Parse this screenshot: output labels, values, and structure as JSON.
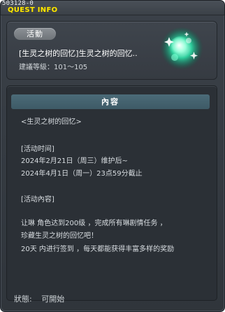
{
  "window": {
    "quest_id": "503128-0",
    "title": "QUEST INFO"
  },
  "quest": {
    "category": "活動",
    "name": "[生灵之树的回忆]生灵之树的回忆..",
    "level": "建議等級：101～105",
    "icon": "glowing-orb-icon"
  },
  "content": {
    "header": "內容",
    "lines": [
      "<生灵之树的回忆>",
      "",
      "[活动时间]",
      "2024年2月21日（周三）维护后~",
      "2024年4月1日（周一）23点59分截止",
      "",
      "[活动內容]",
      "",
      "让琳 角色达到200级 ，完成所有琳剧情任务 ，",
      "珍藏生灵之树的回忆吧！",
      "20天 内进行签到 ，每天都能获得丰富多样的奖励"
    ]
  },
  "status": {
    "label": "狀態:",
    "value": "可開始"
  },
  "colors": {
    "title": "#ffe800",
    "header_bg": "#4b6b78",
    "badge_bg": "#7d8287",
    "text": "#d8dde1"
  }
}
